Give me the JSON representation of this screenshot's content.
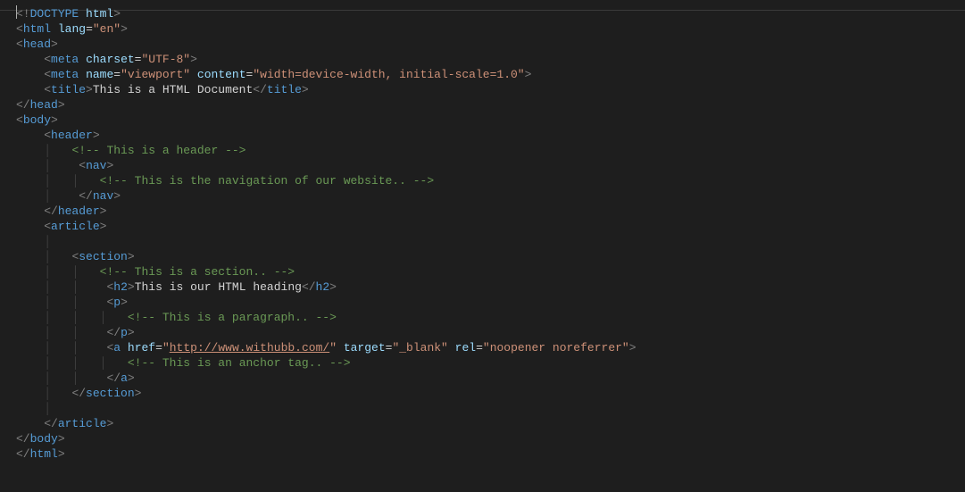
{
  "editor": {
    "lines": [
      {
        "content": [
          {
            "caret": true
          },
          {
            "cls": "t-bracket",
            "t": "<!"
          },
          {
            "cls": "t-doctype",
            "t": "DOCTYPE"
          },
          {
            "cls": "t-text",
            "t": " "
          },
          {
            "cls": "t-attr-name",
            "t": "html"
          },
          {
            "cls": "t-bracket",
            "t": ">"
          }
        ]
      },
      {
        "content": [
          {
            "cls": "t-bracket",
            "t": "<"
          },
          {
            "cls": "t-tag",
            "t": "html"
          },
          {
            "cls": "t-text",
            "t": " "
          },
          {
            "cls": "t-attr-name",
            "t": "lang"
          },
          {
            "cls": "t-text",
            "t": "="
          },
          {
            "cls": "t-attr-value",
            "t": "\"en\""
          },
          {
            "cls": "t-bracket",
            "t": ">"
          }
        ]
      },
      {
        "content": [
          {
            "cls": "t-bracket",
            "t": "<"
          },
          {
            "cls": "t-tag",
            "t": "head"
          },
          {
            "cls": "t-bracket",
            "t": ">"
          }
        ]
      },
      {
        "indent": 1,
        "content": [
          {
            "cls": "t-bracket",
            "t": "<"
          },
          {
            "cls": "t-tag",
            "t": "meta"
          },
          {
            "cls": "t-text",
            "t": " "
          },
          {
            "cls": "t-attr-name",
            "t": "charset"
          },
          {
            "cls": "t-text",
            "t": "="
          },
          {
            "cls": "t-attr-value",
            "t": "\"UTF-8\""
          },
          {
            "cls": "t-bracket",
            "t": ">"
          }
        ]
      },
      {
        "indent": 1,
        "content": [
          {
            "cls": "t-bracket",
            "t": "<"
          },
          {
            "cls": "t-tag",
            "t": "meta"
          },
          {
            "cls": "t-text",
            "t": " "
          },
          {
            "cls": "t-attr-name",
            "t": "name"
          },
          {
            "cls": "t-text",
            "t": "="
          },
          {
            "cls": "t-attr-value",
            "t": "\"viewport\""
          },
          {
            "cls": "t-text",
            "t": " "
          },
          {
            "cls": "t-attr-name",
            "t": "content"
          },
          {
            "cls": "t-text",
            "t": "="
          },
          {
            "cls": "t-attr-value",
            "t": "\"width=device-width, initial-scale=1.0\""
          },
          {
            "cls": "t-bracket",
            "t": ">"
          }
        ]
      },
      {
        "indent": 1,
        "content": [
          {
            "cls": "t-bracket",
            "t": "<"
          },
          {
            "cls": "t-tag",
            "t": "title"
          },
          {
            "cls": "t-bracket",
            "t": ">"
          },
          {
            "cls": "t-text",
            "t": "This is a HTML Document"
          },
          {
            "cls": "t-bracket",
            "t": "</"
          },
          {
            "cls": "t-tag",
            "t": "title"
          },
          {
            "cls": "t-bracket",
            "t": ">"
          }
        ]
      },
      {
        "content": [
          {
            "cls": "t-bracket",
            "t": "</"
          },
          {
            "cls": "t-tag",
            "t": "head"
          },
          {
            "cls": "t-bracket",
            "t": ">"
          }
        ]
      },
      {
        "content": [
          {
            "cls": "t-bracket",
            "t": "<"
          },
          {
            "cls": "t-tag",
            "t": "body"
          },
          {
            "cls": "t-bracket",
            "t": ">"
          }
        ]
      },
      {
        "indent": 1,
        "content": [
          {
            "cls": "t-bracket",
            "t": "<"
          },
          {
            "cls": "t-tag",
            "t": "header"
          },
          {
            "cls": "t-bracket",
            "t": ">"
          }
        ]
      },
      {
        "indent": 2,
        "guide": true,
        "content": [
          {
            "cls": "t-comment",
            "t": "<!-- This is a header -->"
          }
        ]
      },
      {
        "indent": 2,
        "guide": true,
        "padLeft": 1,
        "content": [
          {
            "cls": "t-bracket",
            "t": "<"
          },
          {
            "cls": "t-tag",
            "t": "nav"
          },
          {
            "cls": "t-bracket",
            "t": ">"
          }
        ]
      },
      {
        "indent": 3,
        "guide": true,
        "guide2": true,
        "content": [
          {
            "cls": "t-comment",
            "t": "<!-- This is the navigation of our website.. -->"
          }
        ]
      },
      {
        "indent": 2,
        "guide": true,
        "padLeft": 1,
        "content": [
          {
            "cls": "t-bracket",
            "t": "</"
          },
          {
            "cls": "t-tag",
            "t": "nav"
          },
          {
            "cls": "t-bracket",
            "t": ">"
          }
        ]
      },
      {
        "indent": 1,
        "content": [
          {
            "cls": "t-bracket",
            "t": "</"
          },
          {
            "cls": "t-tag",
            "t": "header"
          },
          {
            "cls": "t-bracket",
            "t": ">"
          }
        ]
      },
      {
        "indent": 1,
        "content": [
          {
            "cls": "t-bracket",
            "t": "<"
          },
          {
            "cls": "t-tag",
            "t": "article"
          },
          {
            "cls": "t-bracket",
            "t": ">"
          }
        ]
      },
      {
        "indent": 1,
        "guide": true,
        "content": []
      },
      {
        "indent": 2,
        "guide": true,
        "content": [
          {
            "cls": "t-bracket",
            "t": "<"
          },
          {
            "cls": "t-tag",
            "t": "section"
          },
          {
            "cls": "t-bracket",
            "t": ">"
          }
        ]
      },
      {
        "indent": 3,
        "guide": true,
        "guide2": true,
        "content": [
          {
            "cls": "t-comment",
            "t": "<!-- This is a section.. -->"
          }
        ]
      },
      {
        "indent": 3,
        "guide": true,
        "guide2": true,
        "padLeft": 1,
        "content": [
          {
            "cls": "t-bracket",
            "t": "<"
          },
          {
            "cls": "t-tag",
            "t": "h2"
          },
          {
            "cls": "t-bracket",
            "t": ">"
          },
          {
            "cls": "t-text",
            "t": "This is our HTML heading"
          },
          {
            "cls": "t-bracket",
            "t": "</"
          },
          {
            "cls": "t-tag",
            "t": "h2"
          },
          {
            "cls": "t-bracket",
            "t": ">"
          }
        ]
      },
      {
        "indent": 3,
        "guide": true,
        "guide2": true,
        "padLeft": 1,
        "content": [
          {
            "cls": "t-bracket",
            "t": "<"
          },
          {
            "cls": "t-tag",
            "t": "p"
          },
          {
            "cls": "t-bracket",
            "t": ">"
          }
        ]
      },
      {
        "indent": 4,
        "guide": true,
        "guide2": true,
        "guide3": true,
        "content": [
          {
            "cls": "t-comment",
            "t": "<!-- This is a paragraph.. -->"
          }
        ]
      },
      {
        "indent": 3,
        "guide": true,
        "guide2": true,
        "padLeft": 1,
        "content": [
          {
            "cls": "t-bracket",
            "t": "</"
          },
          {
            "cls": "t-tag",
            "t": "p"
          },
          {
            "cls": "t-bracket",
            "t": ">"
          }
        ]
      },
      {
        "indent": 3,
        "guide": true,
        "guide2": true,
        "padLeft": 1,
        "content": [
          {
            "cls": "t-bracket",
            "t": "<"
          },
          {
            "cls": "t-tag",
            "t": "a"
          },
          {
            "cls": "t-text",
            "t": " "
          },
          {
            "cls": "t-attr-name",
            "t": "href"
          },
          {
            "cls": "t-text",
            "t": "="
          },
          {
            "cls": "t-attr-value",
            "t": "\""
          },
          {
            "cls": "t-link",
            "t": "http://www.withubb.com/"
          },
          {
            "cls": "t-attr-value",
            "t": "\""
          },
          {
            "cls": "t-text",
            "t": " "
          },
          {
            "cls": "t-attr-name",
            "t": "target"
          },
          {
            "cls": "t-text",
            "t": "="
          },
          {
            "cls": "t-attr-value",
            "t": "\"_blank\""
          },
          {
            "cls": "t-text",
            "t": " "
          },
          {
            "cls": "t-attr-name",
            "t": "rel"
          },
          {
            "cls": "t-text",
            "t": "="
          },
          {
            "cls": "t-attr-value",
            "t": "\"noopener noreferrer\""
          },
          {
            "cls": "t-bracket",
            "t": ">"
          }
        ]
      },
      {
        "indent": 4,
        "guide": true,
        "guide2": true,
        "guide3": true,
        "content": [
          {
            "cls": "t-comment",
            "t": "<!-- This is an anchor tag.. -->"
          }
        ]
      },
      {
        "indent": 3,
        "guide": true,
        "guide2": true,
        "padLeft": 1,
        "content": [
          {
            "cls": "t-bracket",
            "t": "</"
          },
          {
            "cls": "t-tag",
            "t": "a"
          },
          {
            "cls": "t-bracket",
            "t": ">"
          }
        ]
      },
      {
        "indent": 2,
        "guide": true,
        "content": [
          {
            "cls": "t-bracket",
            "t": "</"
          },
          {
            "cls": "t-tag",
            "t": "section"
          },
          {
            "cls": "t-bracket",
            "t": ">"
          }
        ]
      },
      {
        "indent": 1,
        "guide": true,
        "content": []
      },
      {
        "indent": 1,
        "content": [
          {
            "cls": "t-bracket",
            "t": "</"
          },
          {
            "cls": "t-tag",
            "t": "article"
          },
          {
            "cls": "t-bracket",
            "t": ">"
          }
        ]
      },
      {
        "content": [
          {
            "cls": "t-bracket",
            "t": "</"
          },
          {
            "cls": "t-tag",
            "t": "body"
          },
          {
            "cls": "t-bracket",
            "t": ">"
          }
        ]
      },
      {
        "content": [
          {
            "cls": "t-bracket",
            "t": "</"
          },
          {
            "cls": "t-tag",
            "t": "html"
          },
          {
            "cls": "t-bracket",
            "t": ">"
          }
        ]
      }
    ]
  }
}
